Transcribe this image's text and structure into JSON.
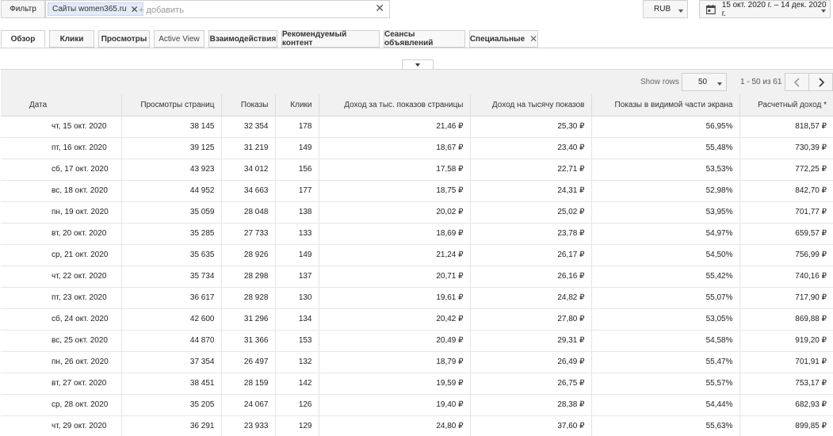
{
  "filter": {
    "label": "Фильтр",
    "chip_label": "Сайты women365.ru",
    "chip_remove": "✕",
    "add_placeholder": "+ добавить",
    "clear": "✕"
  },
  "currency": {
    "value": "RUB"
  },
  "date_range": {
    "value": "15 окт. 2020 г. – 14 дек. 2020 г."
  },
  "tabs": [
    {
      "label": "Обзор",
      "active": true
    },
    {
      "label": "Клики"
    },
    {
      "label": "Просмотры"
    },
    {
      "label": "Active View"
    },
    {
      "label": "Взаимодействия"
    },
    {
      "label": "Рекомендуемый контент"
    },
    {
      "label": "Сеансы объявлений"
    },
    {
      "label": "Специальные",
      "close": "✕"
    }
  ],
  "pagination": {
    "rows_label": "Show rows",
    "rows_value": "50",
    "range": "1 - 50 из 61"
  },
  "table": {
    "columns": [
      "Дата",
      "Просмотры страниц",
      "Показы",
      "Клики",
      "Доход за тыс. показов страницы",
      "Доход на тысячу показов",
      "Показы в видимой части экрана",
      "Расчетный доход *"
    ],
    "rows": [
      [
        "чт, 15 окт. 2020",
        "38 145",
        "32 354",
        "178",
        "21,46 ₽",
        "25,30 ₽",
        "56,95%",
        "818,57 ₽"
      ],
      [
        "пт, 16 окт. 2020",
        "39 125",
        "31 219",
        "149",
        "18,67 ₽",
        "23,40 ₽",
        "55,48%",
        "730,39 ₽"
      ],
      [
        "сб, 17 окт. 2020",
        "43 923",
        "34 012",
        "156",
        "17,58 ₽",
        "22,71 ₽",
        "53,53%",
        "772,25 ₽"
      ],
      [
        "вс, 18 окт. 2020",
        "44 952",
        "34 663",
        "177",
        "18,75 ₽",
        "24,31 ₽",
        "52,98%",
        "842,70 ₽"
      ],
      [
        "пн, 19 окт. 2020",
        "35 059",
        "28 048",
        "138",
        "20,02 ₽",
        "25,02 ₽",
        "53,95%",
        "701,77 ₽"
      ],
      [
        "вт, 20 окт. 2020",
        "35 285",
        "27 733",
        "133",
        "18,69 ₽",
        "23,78 ₽",
        "54,97%",
        "659,57 ₽"
      ],
      [
        "ср, 21 окт. 2020",
        "35 635",
        "28 926",
        "149",
        "21,24 ₽",
        "26,17 ₽",
        "54,50%",
        "756,99 ₽"
      ],
      [
        "чт, 22 окт. 2020",
        "35 734",
        "28 298",
        "137",
        "20,71 ₽",
        "26,16 ₽",
        "55,42%",
        "740,16 ₽"
      ],
      [
        "пт, 23 окт. 2020",
        "36 617",
        "28 928",
        "130",
        "19,61 ₽",
        "24,82 ₽",
        "55,07%",
        "717,90 ₽"
      ],
      [
        "сб, 24 окт. 2020",
        "42 600",
        "31 296",
        "134",
        "20,42 ₽",
        "27,80 ₽",
        "53,05%",
        "869,88 ₽"
      ],
      [
        "вс, 25 окт. 2020",
        "44 870",
        "31 366",
        "153",
        "20,49 ₽",
        "29,31 ₽",
        "54,58%",
        "919,20 ₽"
      ],
      [
        "пн, 26 окт. 2020",
        "37 354",
        "26 497",
        "132",
        "18,79 ₽",
        "26,49 ₽",
        "55,47%",
        "701,91 ₽"
      ],
      [
        "вт, 27 окт. 2020",
        "38 451",
        "28 159",
        "142",
        "19,59 ₽",
        "26,75 ₽",
        "55,57%",
        "753,17 ₽"
      ],
      [
        "ср, 28 окт. 2020",
        "35 205",
        "24 067",
        "126",
        "19,40 ₽",
        "28,38 ₽",
        "54,44%",
        "682,93 ₽"
      ],
      [
        "чт, 29 окт. 2020",
        "36 291",
        "23 933",
        "129",
        "24,80 ₽",
        "37,60 ₽",
        "55,63%",
        "899,85 ₽"
      ]
    ]
  }
}
